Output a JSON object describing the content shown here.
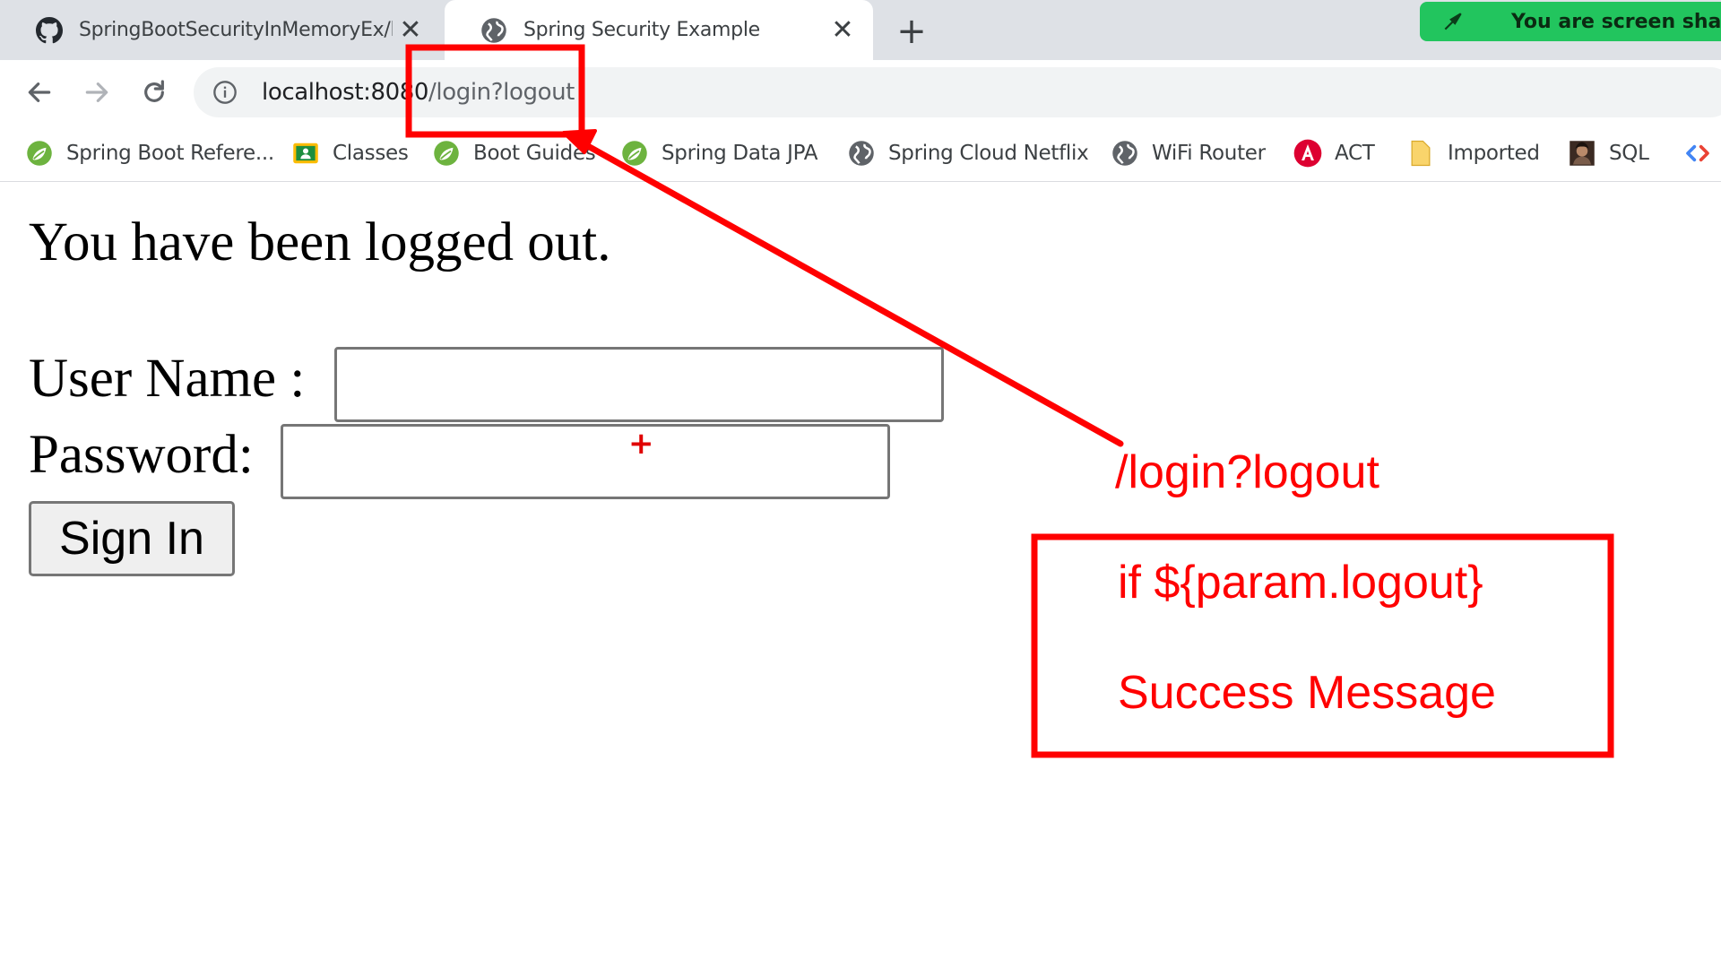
{
  "browser": {
    "tabs": [
      {
        "title": "SpringBootSecurityInMemoryEx/l",
        "icon": "github-icon",
        "active": false
      },
      {
        "title": "Spring Security Example",
        "icon": "globe-icon",
        "active": true
      }
    ],
    "new_tab_label": "+",
    "close_label": "✕",
    "share_banner": {
      "text": "You are screen shari",
      "color": "#22c55e"
    },
    "address_bar": {
      "host": "localhost:8080",
      "path": "/login?logout"
    },
    "bookmarks": [
      {
        "label": "Spring Boot Refere...",
        "icon": "spring-leaf-icon"
      },
      {
        "label": "Classes",
        "icon": "classroom-icon"
      },
      {
        "label": "Boot Guides",
        "icon": "spring-leaf-icon"
      },
      {
        "label": "Spring Data JPA",
        "icon": "spring-leaf-icon"
      },
      {
        "label": "Spring Cloud Netflix",
        "icon": "globe-icon"
      },
      {
        "label": "WiFi Router",
        "icon": "globe-icon"
      },
      {
        "label": "ACT",
        "icon": "angular-icon"
      },
      {
        "label": "Imported",
        "icon": "folder-icon"
      },
      {
        "label": "SQL",
        "icon": "avatar-icon"
      }
    ]
  },
  "page": {
    "logout_message": "You have been logged out.",
    "username_label": "User Name :",
    "password_label": "Password:",
    "username_value": "",
    "password_value": "",
    "signin_label": "Sign In"
  },
  "annotations": {
    "color": "#ff0000",
    "path_label": "/login?logout",
    "condition": "if ${param.logout}",
    "result": "Success Message"
  }
}
